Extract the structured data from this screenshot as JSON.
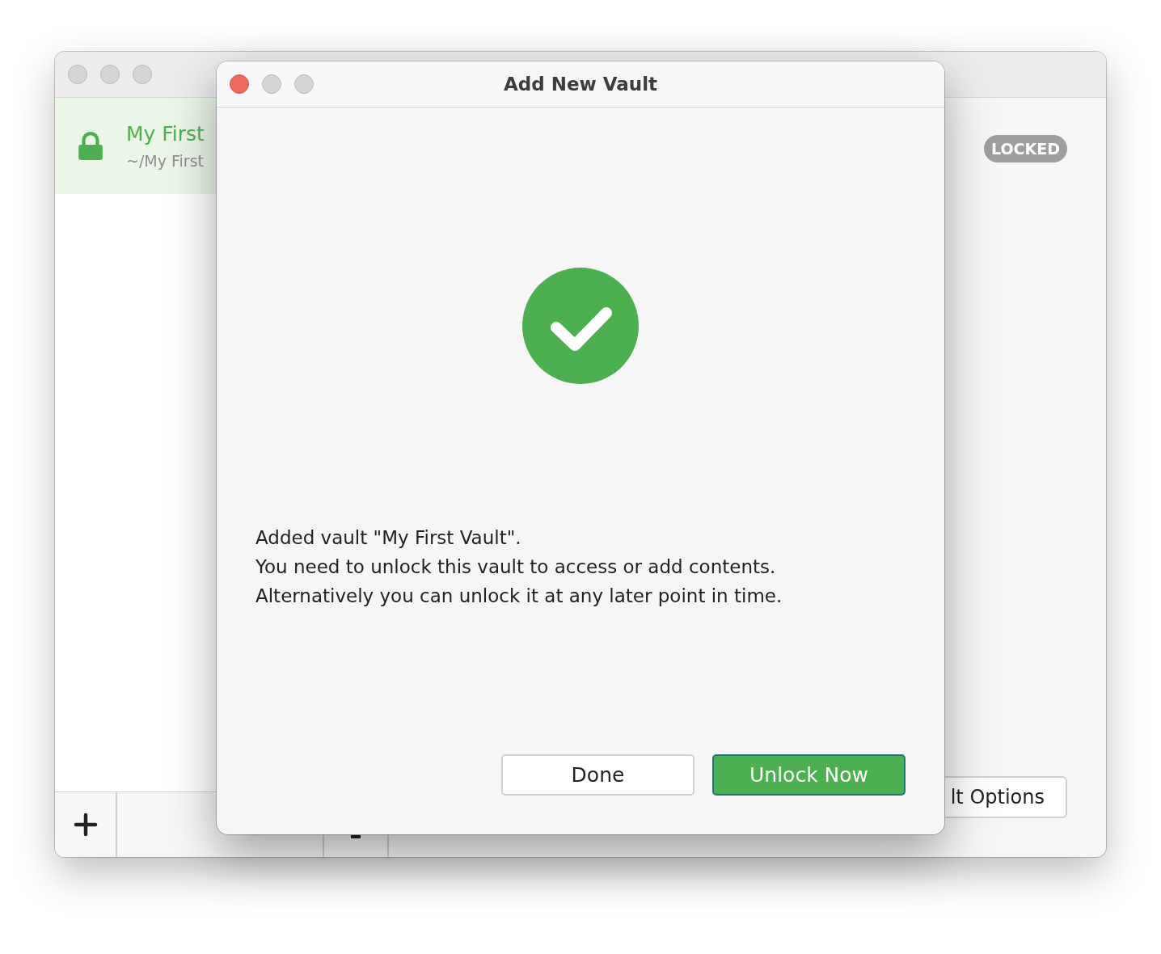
{
  "background_window": {
    "sidebar": {
      "items": [
        {
          "name": "My First",
          "path": "~/My First",
          "selected": true,
          "locked": true
        }
      ]
    },
    "status_badge": "LOCKED",
    "options_button": "lt Options"
  },
  "dialog": {
    "title": "Add New Vault",
    "message": [
      "Added vault \"My First Vault\".",
      "You need to unlock this vault to access or add contents.",
      "Alternatively you can unlock it at any later point in time."
    ],
    "buttons": [
      {
        "label": "Done",
        "kind": "secondary"
      },
      {
        "label": "Unlock Now",
        "kind": "primary"
      }
    ]
  }
}
